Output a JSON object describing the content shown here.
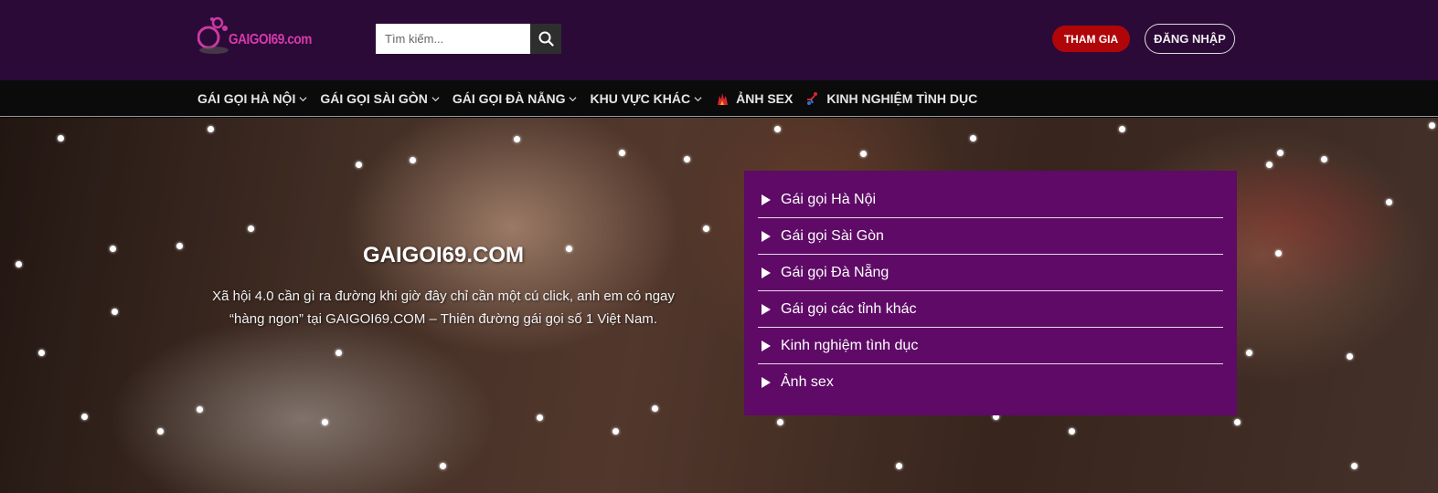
{
  "header": {
    "logo_text": "GAIGOI69.com",
    "search_placeholder": "Tìm kiếm...",
    "join_label": "THAM GIA",
    "login_label": "ĐĂNG NHẬP"
  },
  "nav": {
    "items": [
      {
        "label": "GÁI GỌI HÀ NỘI",
        "dropdown": true
      },
      {
        "label": "GÁI GỌI SÀI GÒN",
        "dropdown": true
      },
      {
        "label": "GÁI GỌI ĐÀ NẴNG",
        "dropdown": true
      },
      {
        "label": "KHU VỰC KHÁC",
        "dropdown": true
      },
      {
        "label": "ẢNH SEX",
        "icon": "flame-icon"
      },
      {
        "label": "KINH NGHIỆM TÌNH DỤC",
        "icon": "figure-icon"
      }
    ]
  },
  "hero": {
    "title": "GAIGOI69.COM",
    "description": "Xã hội 4.0 cần gì ra đường khi giờ đây chỉ cần một cú click, anh em có ngay “hàng ngon” tại GAIGOI69.COM – Thiên đường gái gọi số 1 Việt Nam."
  },
  "menu": {
    "items": [
      "Gái gọi Hà Nội",
      "Gái gọi Sài Gòn",
      "Gái gọi Đà Nẵng",
      "Gái gọi các tỉnh khác",
      "Kinh nghiệm tình dục",
      "Ảnh sex"
    ]
  },
  "colors": {
    "header_bg": "#2b0a38",
    "nav_bg": "#0b0b0b",
    "menu_bg": "#5e0a66",
    "join_btn": "#b0060a"
  }
}
